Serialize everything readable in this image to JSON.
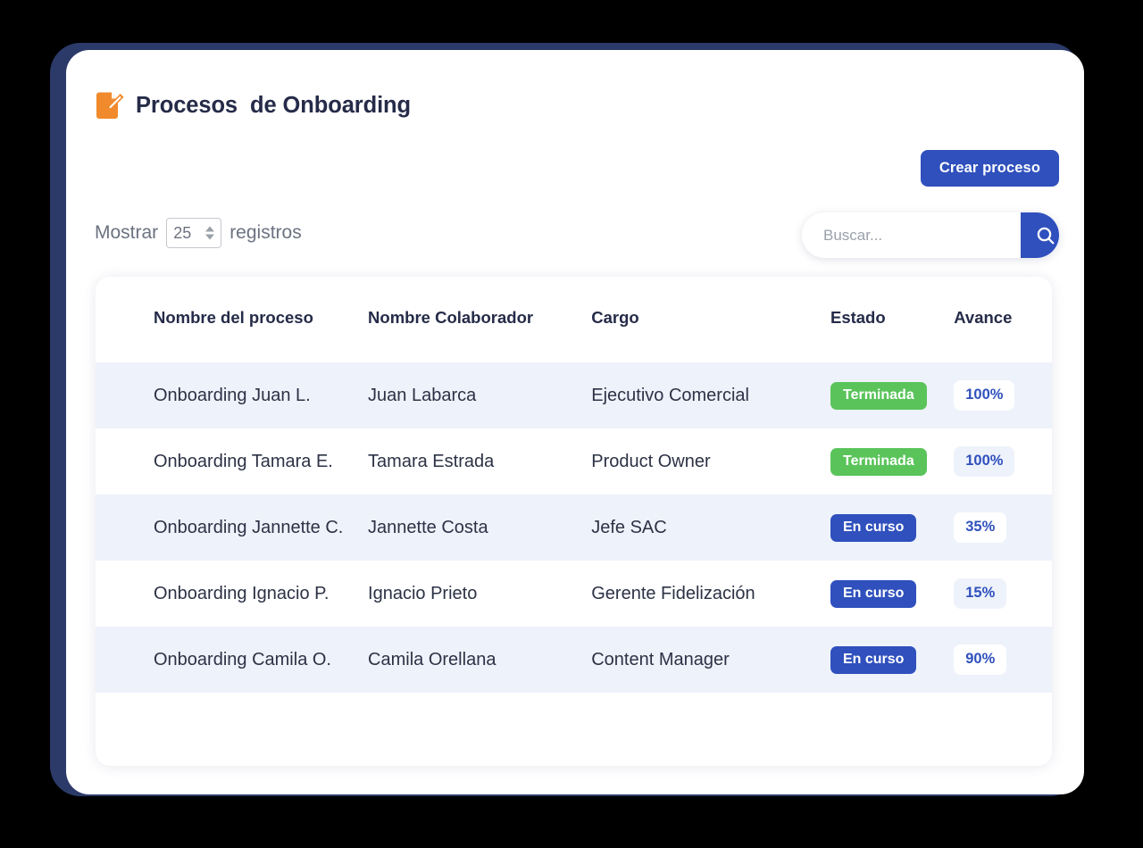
{
  "header": {
    "icon": "edit-document-icon",
    "title": "Procesos  de Onboarding"
  },
  "toolbar": {
    "create_label": "Crear proceso"
  },
  "controls": {
    "length_label": "Mostrar",
    "length_value": "25",
    "length_suffix": "registros",
    "search_placeholder": "Buscar...",
    "search_value": "",
    "search_icon": "magnifier-icon"
  },
  "table": {
    "columns": [
      "Nombre del proceso",
      "Nombre Colaborador",
      "Cargo",
      "Estado",
      "Avance"
    ],
    "rows": [
      {
        "proceso": "Onboarding Juan L.",
        "colaborador": "Juan Labarca",
        "cargo": "Ejecutivo Comercial",
        "estado": "Terminada",
        "estado_type": "terminada",
        "avance": "100%"
      },
      {
        "proceso": "Onboarding Tamara E.",
        "colaborador": "Tamara Estrada",
        "cargo": "Product Owner",
        "estado": "Terminada",
        "estado_type": "terminada",
        "avance": "100%"
      },
      {
        "proceso": "Onboarding Jannette C.",
        "colaborador": "Jannette Costa",
        "cargo": "Jefe SAC",
        "estado": "En curso",
        "estado_type": "encurso",
        "avance": "35%"
      },
      {
        "proceso": "Onboarding Ignacio P.",
        "colaborador": "Ignacio Prieto",
        "cargo": "Gerente Fidelización",
        "estado": "En curso",
        "estado_type": "encurso",
        "avance": "15%"
      },
      {
        "proceso": "Onboarding Camila O.",
        "colaborador": "Camila Orellana",
        "cargo": "Content Manager",
        "estado": "En curso",
        "estado_type": "encurso",
        "avance": "90%"
      }
    ]
  },
  "colors": {
    "accent_blue": "#2f50bd",
    "status_green": "#5ac45a",
    "frame_navy": "#2b3a68",
    "icon_orange": "#f08a2c",
    "row_stripe": "#eef2fb",
    "heading_navy": "#252b48"
  }
}
